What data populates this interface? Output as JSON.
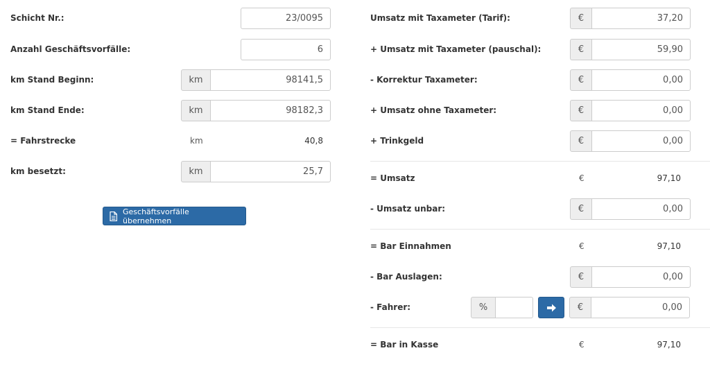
{
  "left": {
    "schicht_label": "Schicht Nr.:",
    "schicht_value": "23/0095",
    "anzahl_label": "Anzahl Geschäftsvorfälle:",
    "anzahl_value": "6",
    "km_beginn_label": "km Stand Beginn:",
    "km_beginn_unit": "km",
    "km_beginn_value": "98141,5",
    "km_ende_label": "km Stand Ende:",
    "km_ende_unit": "km",
    "km_ende_value": "98182,3",
    "fahrstrecke_label": "= Fahrstrecke",
    "fahrstrecke_unit": "km",
    "fahrstrecke_value": "40,8",
    "besetzt_label": "km besetzt:",
    "besetzt_unit": "km",
    "besetzt_value": "25,7",
    "uebernehmen_button": "Geschäftsvorfälle übernehmen",
    "document_icon": "document-icon"
  },
  "right": {
    "currency": "€",
    "tarif_label": "Umsatz mit Taxameter (Tarif):",
    "tarif_value": "37,20",
    "pauschal_label": "+ Umsatz mit Taxameter (pauschal):",
    "pauschal_value": "59,90",
    "korrektur_label": "- Korrektur Taxameter:",
    "korrektur_value": "0,00",
    "ohne_label": "+ Umsatz ohne Taxameter:",
    "ohne_value": "0,00",
    "trinkgeld_label": "+ Trinkgeld",
    "trinkgeld_value": "0,00",
    "umsatz_label": "= Umsatz",
    "umsatz_value": "97,10",
    "unbar_label": "- Umsatz unbar:",
    "unbar_value": "0,00",
    "bar_einnahmen_label": "= Bar Einnahmen",
    "bar_einnahmen_value": "97,10",
    "bar_auslagen_label": "- Bar Auslagen:",
    "bar_auslagen_value": "0,00",
    "fahrer_label": "- Fahrer:",
    "fahrer_percent_unit": "%",
    "fahrer_percent_value": "",
    "fahrer_value": "0,00",
    "arrow_icon": "arrow-right-icon",
    "kasse_label": "= Bar in Kasse",
    "kasse_value": "97,10"
  },
  "colors": {
    "primary": "#2c6aa6",
    "addon_bg": "#eeeeee",
    "border": "#cccccc"
  }
}
